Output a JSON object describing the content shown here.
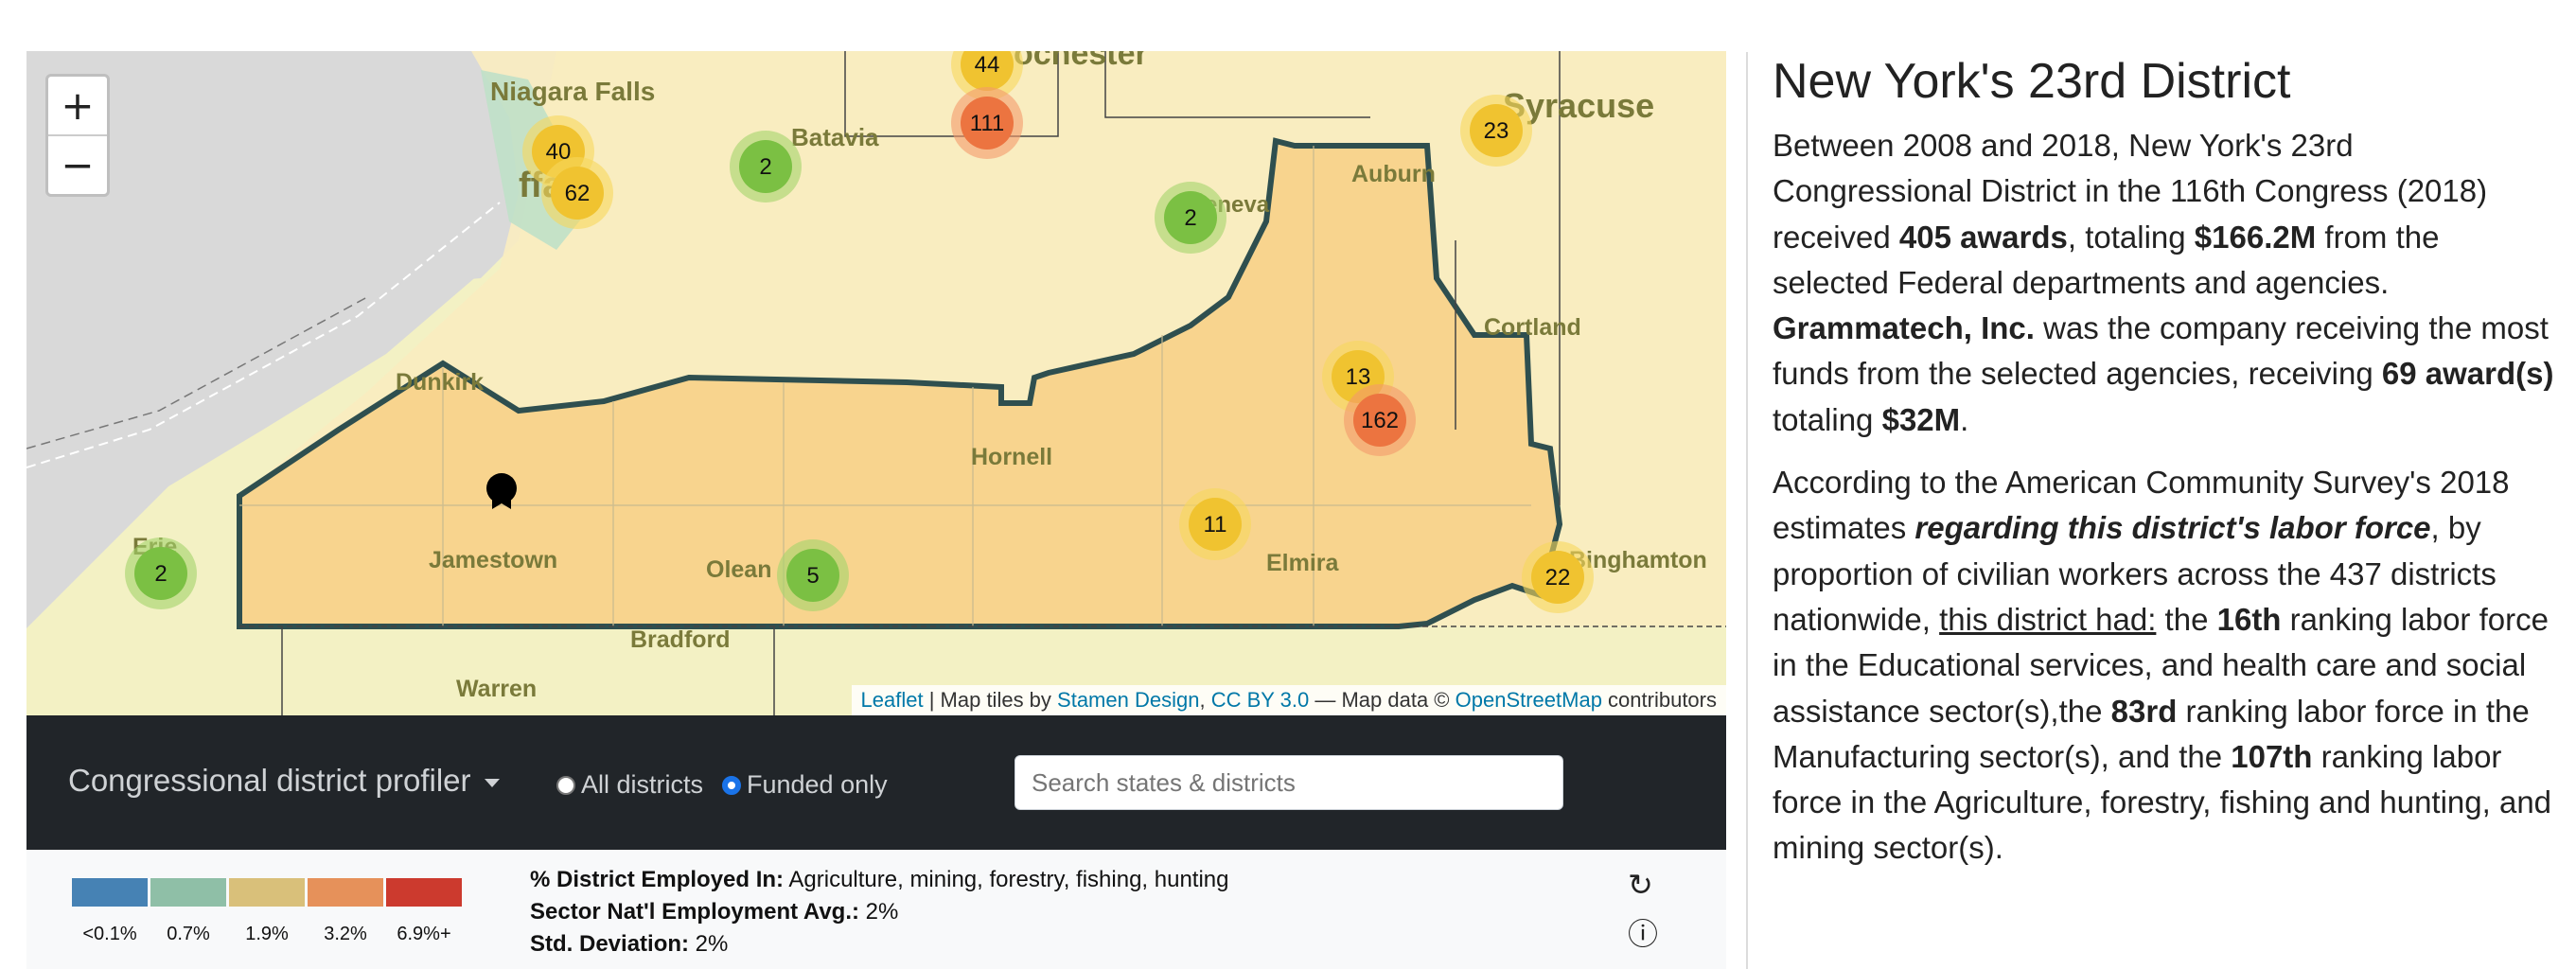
{
  "map": {
    "zoom_in": "+",
    "zoom_out": "−",
    "place_labels": [
      {
        "text": "Niagara Falls"
      },
      {
        "text": "ffalo"
      },
      {
        "text": "Batavia"
      },
      {
        "text": "ochester"
      },
      {
        "text": "Syracuse"
      },
      {
        "text": "Auburn"
      },
      {
        "text": "eneva"
      },
      {
        "text": "Cortland"
      },
      {
        "text": "Dunkirk"
      },
      {
        "text": "Hornell"
      },
      {
        "text": "Jamestown"
      },
      {
        "text": "Olean"
      },
      {
        "text": "Elmira"
      },
      {
        "text": "Binghamton"
      },
      {
        "text": "Bradford"
      },
      {
        "text": "Warren"
      },
      {
        "text": "Erie"
      }
    ],
    "clusters": [
      {
        "count": "44",
        "level": "mid"
      },
      {
        "count": "111",
        "level": "high"
      },
      {
        "count": "40",
        "level": "mid"
      },
      {
        "count": "62",
        "level": "mid"
      },
      {
        "count": "2",
        "level": "low"
      },
      {
        "count": "2",
        "level": "low"
      },
      {
        "count": "23",
        "level": "mid"
      },
      {
        "count": "13",
        "level": "mid"
      },
      {
        "count": "162",
        "level": "high"
      },
      {
        "count": "11",
        "level": "mid"
      },
      {
        "count": "5",
        "level": "low"
      },
      {
        "count": "22",
        "level": "mid"
      },
      {
        "count": "2",
        "level": "low"
      }
    ],
    "attribution": {
      "leaflet": "Leaflet",
      "sep1": " | Map tiles by ",
      "stamen": "Stamen Design",
      "sep2": ", ",
      "cc": "CC BY 3.0",
      "sep3": " — Map data © ",
      "osm": "OpenStreetMap",
      "sep4": " contributors"
    }
  },
  "toolbar": {
    "profiler_label": "Congressional district profiler",
    "radio_all": "All districts",
    "radio_funded": "Funded only",
    "selected_filter": "Funded only",
    "search_placeholder": "Search states & districts"
  },
  "legend": {
    "colors": [
      "#4682b4",
      "#8fbfa7",
      "#d9c07a",
      "#e6915a",
      "#cc3a2e"
    ],
    "labels": [
      "<0.1%",
      "0.7%",
      "1.9%",
      "3.2%",
      "6.9%+"
    ],
    "employed_label": "% District Employed In:",
    "employed_value": " Agriculture, mining, forestry, fishing, hunting",
    "avg_label": "Sector Nat'l Employment Avg.:",
    "avg_value": " 2%",
    "std_label": "Std. Deviation:",
    "std_value": " 2%",
    "refresh_icon": "↻",
    "info_icon": "ⓘ"
  },
  "district": {
    "title": "New York's 23rd District",
    "p1_a": "Between 2008 and 2018, New York's 23rd Congressional District in the 116th Congress (2018) received ",
    "p1_awards": "405 awards",
    "p1_b": ", totaling ",
    "p1_total": "$166.2M",
    "p1_c": " from the selected Federal departments and agencies. ",
    "p1_company": "Grammatech, Inc.",
    "p1_d": " was the company receiving the most funds from the selected agencies, receiving ",
    "p1_company_awards": "69 award(s)",
    "p1_e": " totaling ",
    "p1_company_total": "$32M",
    "p1_f": ".",
    "p2_a": "According to the American Community Survey's 2018 estimates ",
    "p2_emph": "regarding this district's labor force",
    "p2_b": ", by proportion of civilian workers across the 437 districts nationwide, ",
    "p2_u": "this district had:",
    "p2_c": " the ",
    "p2_r1": "16th",
    "p2_d": " ranking labor force in the Educational services, and health care and social assistance sector(s),the ",
    "p2_r2": "83rd",
    "p2_e": " ranking labor force in the Manufacturing sector(s), and the ",
    "p2_r3": "107th",
    "p2_f": " ranking labor force in the Agriculture, forestry, fishing and hunting, and mining sector(s)."
  }
}
